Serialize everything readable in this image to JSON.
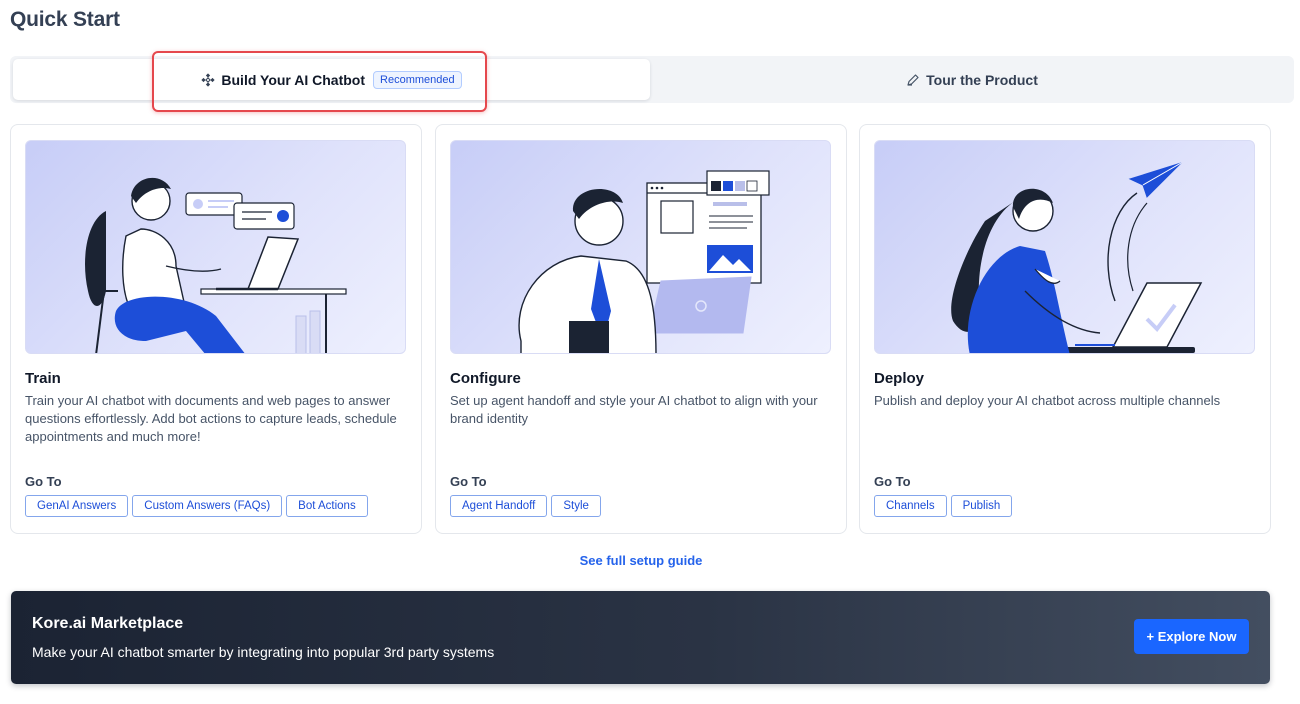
{
  "page": {
    "title": "Quick Start"
  },
  "tabs": [
    {
      "label": "Build Your AI Chatbot",
      "badge": "Recommended",
      "icon": "sparkle-grid-icon",
      "active": true
    },
    {
      "label": "Tour the Product",
      "icon": "pen-icon",
      "active": false
    }
  ],
  "cards": [
    {
      "title": "Train",
      "description": "Train your AI chatbot with documents and web pages to answer questions effortlessly. Add bot actions to capture leads, schedule appointments and much more!",
      "goto_label": "Go To",
      "chips": [
        "GenAI Answers",
        "Custom Answers (FAQs)",
        "Bot Actions"
      ]
    },
    {
      "title": "Configure",
      "description": "Set up agent handoff and style your AI chatbot to align with your brand identity",
      "goto_label": "Go To",
      "chips": [
        "Agent Handoff",
        "Style"
      ]
    },
    {
      "title": "Deploy",
      "description": "Publish and deploy your AI chatbot across multiple channels",
      "goto_label": "Go To",
      "chips": [
        "Channels",
        "Publish"
      ]
    }
  ],
  "setup_link": "See full setup guide",
  "marketplace": {
    "title": "Kore.ai Marketplace",
    "subtitle": "Make your AI chatbot smarter by integrating into popular 3rd party systems",
    "button_label": "+ Explore Now"
  },
  "colors": {
    "accent": "#1a66ff",
    "link": "#2563eb",
    "highlight": "#e5484d",
    "illustration_blue": "#1d4ed8"
  }
}
